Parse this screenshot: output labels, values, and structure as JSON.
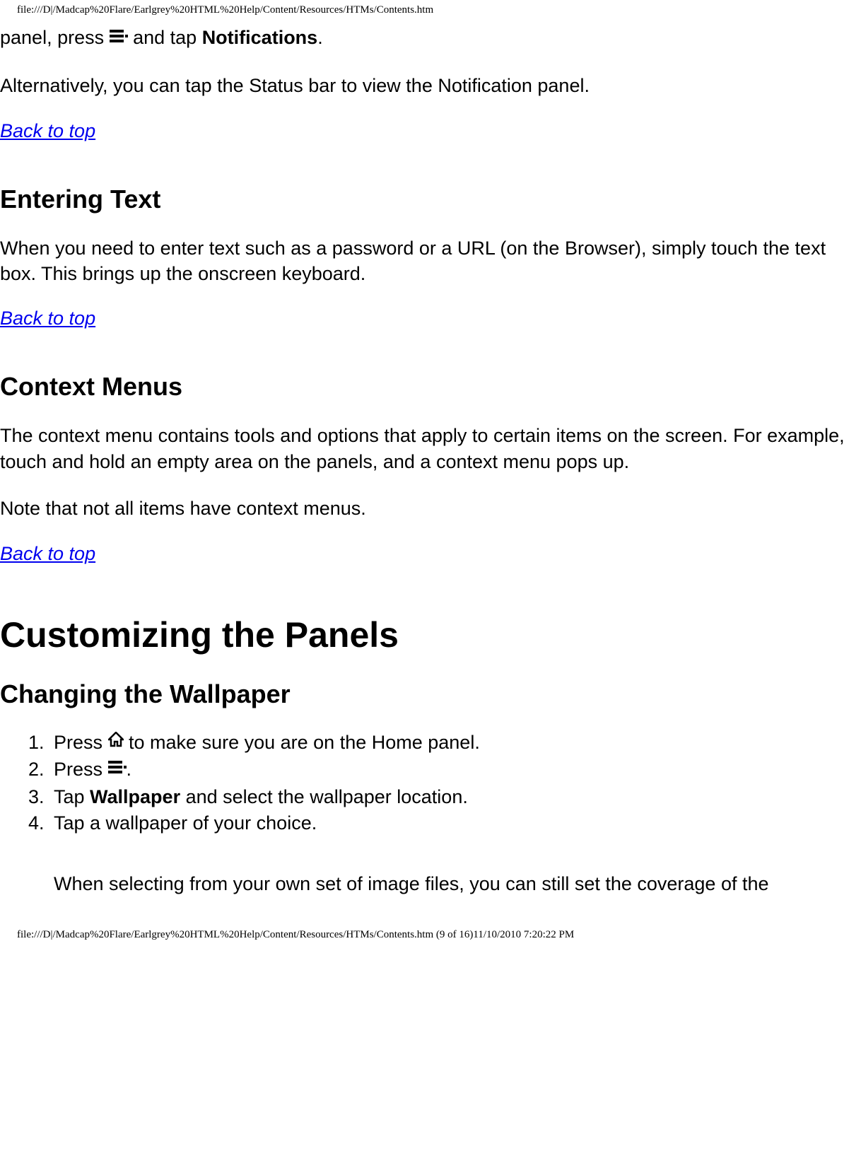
{
  "header": {
    "path": "file:///D|/Madcap%20Flare/Earlgrey%20HTML%20Help/Content/Resources/HTMs/Contents.htm"
  },
  "section1": {
    "p1_part1": "panel, press ",
    "p1_part2": " and tap ",
    "p1_bold": "Notifications",
    "p1_part3": ".",
    "p2": "Alternatively, you can tap the Status bar to view the Notification panel.",
    "backtop": "Back to top"
  },
  "section2": {
    "heading": "Entering Text",
    "p1": "When you need to enter text such as a password or a URL (on the Browser), simply touch the text box. This brings up the onscreen keyboard.",
    "backtop": "Back to top"
  },
  "section3": {
    "heading": "Context Menus",
    "p1": "The context menu contains tools and options that apply to certain items on the screen. For example, touch and hold an empty area on the panels, and a context menu pops up.",
    "p2": "Note that not all items have context menus.",
    "backtop": "Back to top"
  },
  "section4": {
    "heading": "Customizing the Panels",
    "subheading": "Changing the Wallpaper",
    "steps": {
      "s1_part1": "Press ",
      "s1_part2": " to make sure you are on the Home panel.",
      "s2_part1": "Press ",
      "s2_part2": ".",
      "s3_part1": "Tap ",
      "s3_bold": "Wallpaper",
      "s3_part2": " and select the wallpaper location.",
      "s4": "Tap a wallpaper of your choice."
    },
    "note": "When selecting from your own set of image files, you can still set the coverage of the"
  },
  "footer": {
    "path": "file:///D|/Madcap%20Flare/Earlgrey%20HTML%20Help/Content/Resources/HTMs/Contents.htm (9 of 16)11/10/2010 7:20:22 PM"
  }
}
